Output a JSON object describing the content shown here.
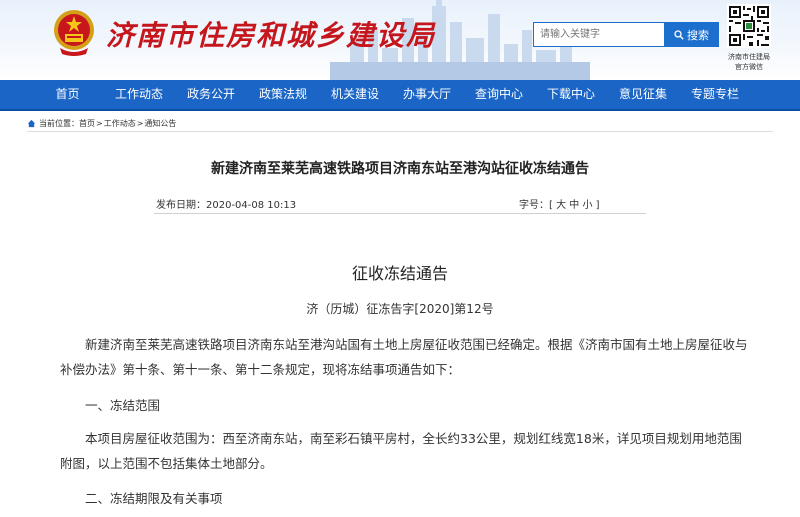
{
  "header": {
    "site_title": "济南市住房和城乡建设局",
    "search_placeholder": "请输入关键字",
    "search_button": "搜索",
    "qr_caption_line1": "济南市住建局",
    "qr_caption_line2": "官方微信"
  },
  "nav": {
    "items": [
      "首页",
      "工作动态",
      "政务公开",
      "政策法规",
      "机关建设",
      "办事大厅",
      "查询中心",
      "下载中心",
      "意见征集",
      "专题专栏"
    ]
  },
  "breadcrumb": {
    "label": "当前位置：",
    "items": [
      "首页",
      "工作动态",
      "通知公告"
    ],
    "separator": ">"
  },
  "article": {
    "title": "新建济南至莱芜高速铁路项目济南东站至港沟站征收冻结通告",
    "publish_label": "发布日期：",
    "publish_date": "2020-04-08 10:13",
    "font_size_label": "字号：",
    "font_sizes": [
      "大",
      "中",
      "小"
    ],
    "doc_heading": "征收冻结通告",
    "doc_number": "济（历城）征冻告字[2020]第12号",
    "paragraph1": "新建济南至莱芜高速铁路项目济南东站至港沟站国有土地上房屋征收范围已经确定。根据《济南市国有土地上房屋征收与补偿办法》第十条、第十一条、第十二条规定，现将冻结事项通告如下：",
    "section1": "一、冻结范围",
    "paragraph2": "本项目房屋征收范围为：西至济南东站，南至彩石镇平房村，全长约33公里，规划红线宽18米，详见项目规划用地范围附图，以上范围不包括集体土地部分。",
    "section2": "二、冻结期限及有关事项"
  },
  "colors": {
    "nav_bg": "#1a65c6",
    "title_red": "#c4161c",
    "search_blue": "#1d6fcd"
  }
}
